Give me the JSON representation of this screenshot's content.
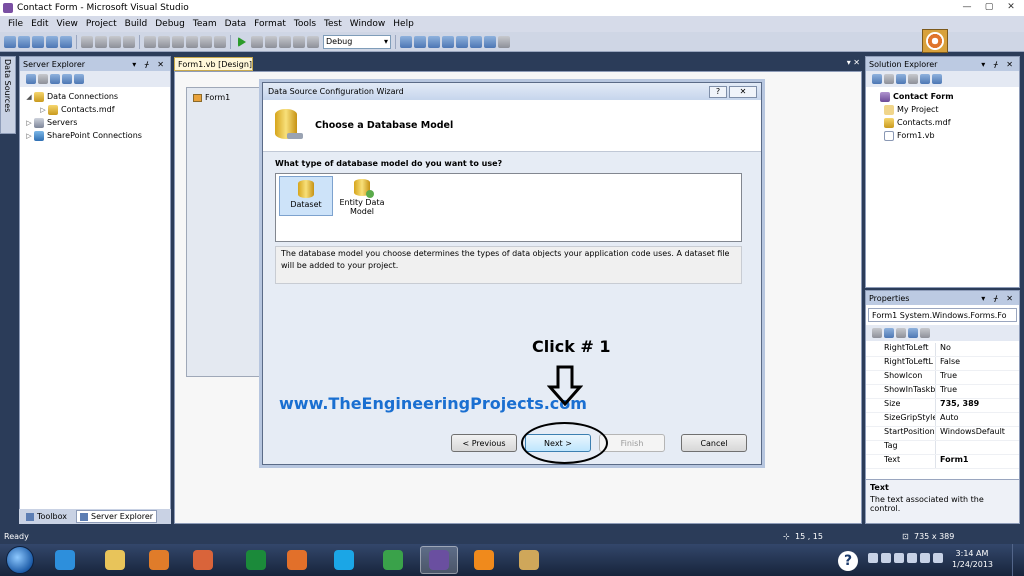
{
  "window": {
    "title": "Contact Form - Microsoft Visual Studio",
    "minimize": "—",
    "maximize": "▢",
    "close": "✕"
  },
  "menu": [
    "File",
    "Edit",
    "View",
    "Project",
    "Build",
    "Debug",
    "Team",
    "Data",
    "Format",
    "Tools",
    "Test",
    "Window",
    "Help"
  ],
  "toolbar": {
    "configuration": "Debug"
  },
  "left_tab": "Data Sources",
  "server_explorer": {
    "title": "Server Explorer",
    "pins": "▾ ᚋ ✕",
    "items": [
      {
        "label": "Data Connections",
        "exp": "◢",
        "indent": 0,
        "icon": "database-icon"
      },
      {
        "label": "Contacts.mdf",
        "exp": "▷",
        "indent": 1,
        "icon": "database-icon"
      },
      {
        "label": "Servers",
        "exp": "▷",
        "indent": 0,
        "icon": "server-icon"
      },
      {
        "label": "SharePoint Connections",
        "exp": "▷",
        "indent": 0,
        "icon": "sharepoint-icon"
      }
    ]
  },
  "bottom_tabs": {
    "toolbox": "Toolbox",
    "server_explorer": "Server Explorer"
  },
  "document": {
    "tab": "Form1.vb [Design]",
    "form_title": "Form1",
    "right_ctrl": "▾ ✕"
  },
  "wizard": {
    "title": "Data Source Configuration Wizard",
    "help": "?",
    "close": "✕",
    "heading": "Choose a Database Model",
    "question": "What type of database model do you want to use?",
    "models": [
      "Dataset",
      "Entity Data Model"
    ],
    "description": "The database model you choose determines the types of data objects your application code uses. A dataset file will be added to your project.",
    "buttons": {
      "previous": "< Previous",
      "next": "Next >",
      "finish": "Finish",
      "cancel": "Cancel"
    }
  },
  "annotations": {
    "website": "www.TheEngineeringProjects.com",
    "callout": "Click # 1"
  },
  "solution_explorer": {
    "title": "Solution Explorer",
    "pins": "▾ ᚋ ✕",
    "items": [
      {
        "label": "Contact Form",
        "bold": true,
        "indent": 0,
        "icon": "project-icon"
      },
      {
        "label": "My Project",
        "indent": 1,
        "icon": "folder-icon"
      },
      {
        "label": "Contacts.mdf",
        "indent": 1,
        "icon": "database-icon"
      },
      {
        "label": "Form1.vb",
        "indent": 1,
        "icon": "form-file-icon"
      }
    ]
  },
  "properties": {
    "title": "Properties",
    "pins": "▾ ᚋ ✕",
    "object": "Form1 System.Windows.Forms.Fo",
    "rows": [
      {
        "name": "RightToLeft",
        "value": "No"
      },
      {
        "name": "RightToLeftL",
        "value": "False"
      },
      {
        "name": "ShowIcon",
        "value": "True"
      },
      {
        "name": "ShowInTaskb",
        "value": "True"
      },
      {
        "name": "Size",
        "value": "735, 389",
        "bold": true,
        "expandable": true
      },
      {
        "name": "SizeGripStyle",
        "value": "Auto"
      },
      {
        "name": "StartPosition",
        "value": "WindowsDefault"
      },
      {
        "name": "Tag",
        "value": ""
      },
      {
        "name": "Text",
        "value": "Form1",
        "bold": true
      }
    ],
    "desc_title": "Text",
    "desc_text": "The text associated with the control."
  },
  "status": {
    "ready": "Ready",
    "position": "15 , 15",
    "size": "735 x 389"
  },
  "taskbar": {
    "apps": [
      {
        "name": "internet-explorer-icon",
        "color": "#2d8fdc"
      },
      {
        "name": "file-explorer-icon",
        "color": "#e8c45a"
      },
      {
        "name": "media-player-icon",
        "color": "#e07c2a"
      },
      {
        "name": "presentation-icon",
        "color": "#d9643a"
      },
      {
        "name": "hp-icon",
        "color": "#1b8a3a"
      },
      {
        "name": "firefox-icon",
        "color": "#e2702a"
      },
      {
        "name": "skype-icon",
        "color": "#1ba6e6"
      },
      {
        "name": "messenger-icon",
        "color": "#3aa24a"
      },
      {
        "name": "visual-studio-icon",
        "color": "#6a4fa0"
      },
      {
        "name": "vlc-icon",
        "color": "#f08a1c"
      },
      {
        "name": "paint-icon",
        "color": "#cfa75a"
      }
    ],
    "time": "3:14 AM",
    "date": "1/24/2013"
  }
}
